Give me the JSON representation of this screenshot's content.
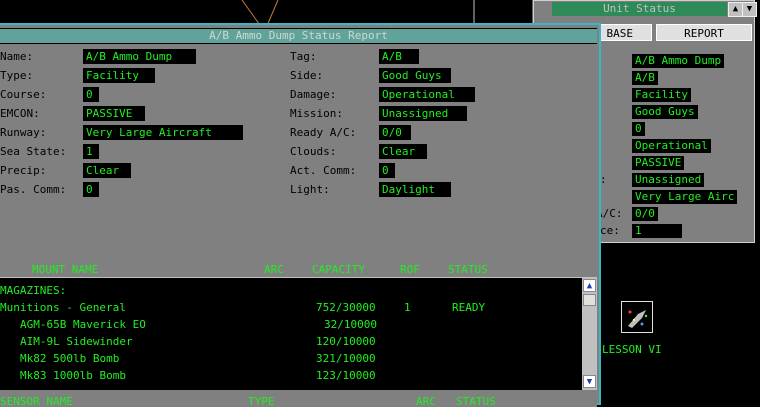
{
  "unit_status": {
    "title": "Unit Status",
    "up_arrow": "▲",
    "down_arrow": "▼",
    "base_button": "BASE",
    "report_button": "REPORT",
    "values": [
      "A/B Ammo Dump",
      "A/B",
      "Facility",
      "Good Guys",
      "0",
      "Operational",
      "PASSIVE",
      "Unassigned",
      "Very Large Airc",
      "0/0",
      "1"
    ],
    "partial_labels": [
      ":",
      "A/C:",
      "ce:"
    ]
  },
  "lesson": {
    "icon": "lesson-icon",
    "label": "LESSON VI"
  },
  "report": {
    "title": "A/B Ammo Dump Status Report",
    "fields": {
      "name": {
        "label": "Name:",
        "value": "A/B Ammo Dump"
      },
      "type": {
        "label": "Type:",
        "value": "Facility"
      },
      "course": {
        "label": "Course:",
        "value": "0"
      },
      "emcon": {
        "label": "EMCON:",
        "value": "PASSIVE"
      },
      "runway": {
        "label": "Runway:",
        "value": "Very Large Aircraft"
      },
      "sea_state": {
        "label": "Sea State:",
        "value": "1"
      },
      "precip": {
        "label": "Precip:",
        "value": "Clear"
      },
      "pas_comm": {
        "label": "Pas. Comm:",
        "value": "0"
      },
      "tag": {
        "label": "Tag:",
        "value": "A/B"
      },
      "side": {
        "label": "Side:",
        "value": "Good Guys"
      },
      "damage": {
        "label": "Damage:",
        "value": "Operational"
      },
      "mission": {
        "label": "Mission:",
        "value": "Unassigned"
      },
      "ready_ac": {
        "label": "Ready A/C:",
        "value": "0/0"
      },
      "clouds": {
        "label": "Clouds:",
        "value": "Clear"
      },
      "act_comm": {
        "label": "Act. Comm:",
        "value": "0"
      },
      "light": {
        "label": "Light:",
        "value": "Daylight"
      }
    }
  },
  "mount_table": {
    "headers": {
      "mount_name": "MOUNT NAME",
      "arc": "ARC",
      "capacity": "CAPACITY",
      "rof": "ROF",
      "status": "STATUS"
    },
    "rows": [
      {
        "name": "MAGAZINES:",
        "capacity": "",
        "rof": "",
        "status": ""
      },
      {
        "name": "Munitions - General",
        "capacity": "752/30000",
        "rof": "1",
        "status": "READY"
      },
      {
        "name": "   AGM-65B Maverick EO",
        "capacity": "32/10000",
        "rof": "",
        "status": ""
      },
      {
        "name": "   AIM-9L Sidewinder",
        "capacity": "120/10000",
        "rof": "",
        "status": ""
      },
      {
        "name": "   Mk82 500lb Bomb",
        "capacity": "321/10000",
        "rof": "",
        "status": ""
      },
      {
        "name": "   Mk83 1000lb Bomb",
        "capacity": "123/10000",
        "rof": "",
        "status": ""
      }
    ],
    "scroll_up": "▲",
    "scroll_down": "▼"
  },
  "sensor_table": {
    "headers": {
      "sensor_name": "SENSOR NAME",
      "type": "TYPE",
      "arc": "ARC",
      "status": "STATUS"
    }
  },
  "colors": {
    "text_green": "#22ee22",
    "panel_gray": "#808080",
    "title_teal": "#5fa39a",
    "window_border": "#3ab7c4"
  }
}
